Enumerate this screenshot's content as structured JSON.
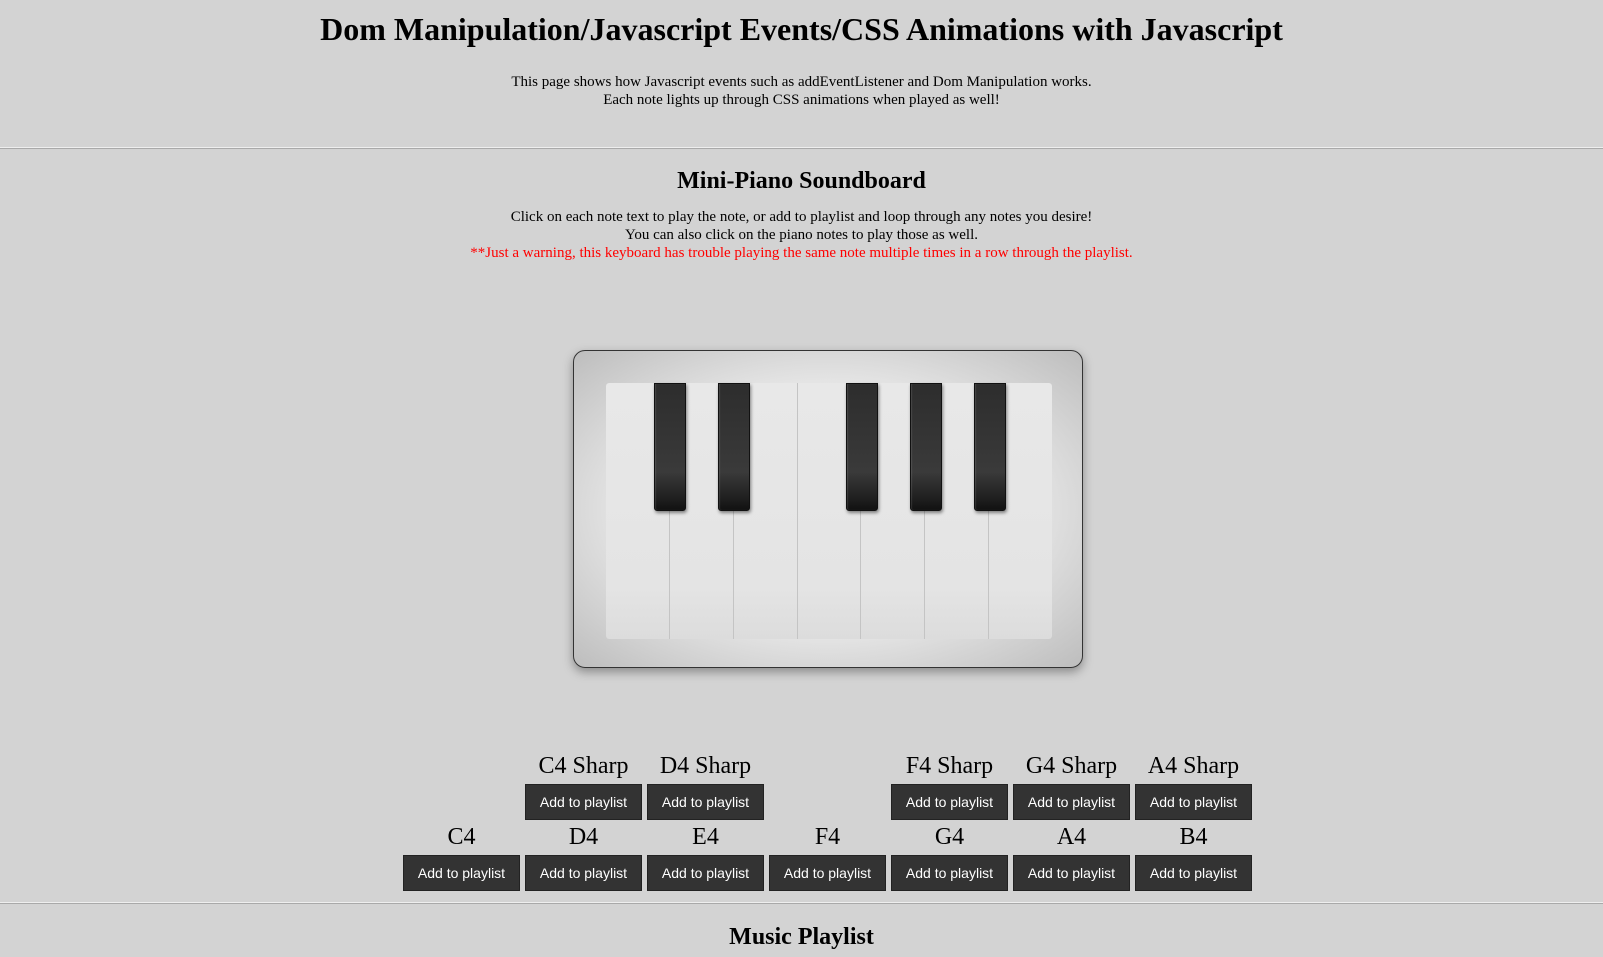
{
  "header": {
    "title": "Dom Manipulation/Javascript Events/CSS Animations with Javascript",
    "desc_line1": "This page shows how Javascript events such as addEventListener and Dom Manipulation works.",
    "desc_line2": "Each note lights up through CSS animations when played as well!"
  },
  "soundboard": {
    "title": "Mini-Piano Soundboard",
    "instr_line1": "Click on each note text to play the note, or add to playlist and loop through any notes you desire!",
    "instr_line2": "You can also click on the piano notes to play those as well.",
    "warning": "**Just a warning, this keyboard has trouble playing the same note multiple times in a row through the playlist."
  },
  "sharps": [
    {
      "label": "C4 Sharp",
      "button": "Add to playlist"
    },
    {
      "label": "D4 Sharp",
      "button": "Add to playlist"
    },
    {
      "label": "F4 Sharp",
      "button": "Add to playlist"
    },
    {
      "label": "G4 Sharp",
      "button": "Add to playlist"
    },
    {
      "label": "A4 Sharp",
      "button": "Add to playlist"
    }
  ],
  "naturals": [
    {
      "label": "C4",
      "button": "Add to playlist"
    },
    {
      "label": "D4",
      "button": "Add to playlist"
    },
    {
      "label": "E4",
      "button": "Add to playlist"
    },
    {
      "label": "F4",
      "button": "Add to playlist"
    },
    {
      "label": "G4",
      "button": "Add to playlist"
    },
    {
      "label": "A4",
      "button": "Add to playlist"
    },
    {
      "label": "B4",
      "button": "Add to playlist"
    }
  ],
  "playlist": {
    "title": "Music Playlist"
  },
  "colors": {
    "background": "#d3d3d3",
    "button": "#333333",
    "warning": "#ff0000"
  }
}
